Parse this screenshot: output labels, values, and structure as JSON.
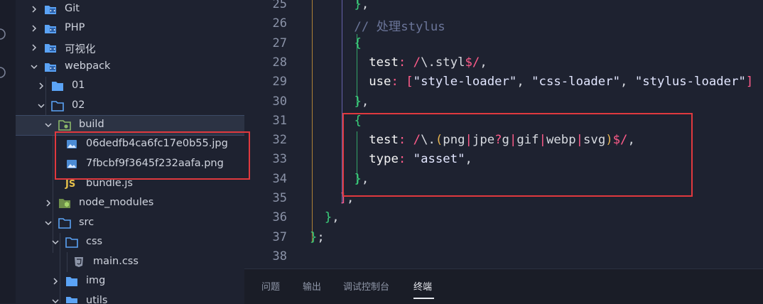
{
  "explorer": {
    "items": [
      {
        "label": "Git",
        "icon": "folder-git-icon"
      },
      {
        "label": "PHP",
        "icon": "folder-code-icon"
      },
      {
        "label": "可视化",
        "icon": "folder-code-icon"
      },
      {
        "label": "webpack",
        "icon": "folder-code-icon"
      },
      {
        "label": "01",
        "icon": "folder-icon"
      },
      {
        "label": "02",
        "icon": "folder-open-icon"
      },
      {
        "label": "build",
        "icon": "folder-build-icon"
      },
      {
        "label": "06dedfb4ca6fc17e0b55.jpg",
        "icon": "image-file-icon"
      },
      {
        "label": "7fbcbf9f3645f232aafa.png",
        "icon": "image-file-icon"
      },
      {
        "label": "bundle.js",
        "icon": "js-file-icon"
      },
      {
        "label": "node_modules",
        "icon": "folder-node-icon"
      },
      {
        "label": "src",
        "icon": "folder-open-icon"
      },
      {
        "label": "css",
        "icon": "folder-open-icon"
      },
      {
        "label": "main.css",
        "icon": "css-file-icon"
      },
      {
        "label": "img",
        "icon": "folder-icon"
      },
      {
        "label": "utils",
        "icon": "folder-icon"
      }
    ],
    "icons": {
      "js": "JS"
    }
  },
  "editor": {
    "line_numbers": [
      "25",
      "26",
      "27",
      "28",
      "29",
      "30",
      "31",
      "32",
      "33",
      "34",
      "35",
      "36",
      "37",
      "38"
    ],
    "lines": [
      [
        {
          "t": "      },"
        }
      ],
      [
        {
          "t": "      // 处理stylus"
        }
      ],
      [
        {
          "t": "      {"
        }
      ],
      [
        {
          "t": "        test: /\\.styl$/,"
        }
      ],
      [
        {
          "t": "        use: [\"style-loader\", \"css-loader\", \"stylus-loader\"]"
        }
      ],
      [
        {
          "t": "      },"
        }
      ],
      [
        {
          "t": "      {"
        }
      ],
      [
        {
          "t": "        test: /\\.(png|jpe?g|gif|webp|svg)$/,"
        }
      ],
      [
        {
          "t": "        type: \"asset\","
        }
      ],
      [
        {
          "t": "      },"
        }
      ],
      [
        {
          "t": "    ],"
        }
      ],
      [
        {
          "t": "  },"
        }
      ],
      [
        {
          "t": "};"
        }
      ],
      [
        {
          "t": ""
        }
      ]
    ]
  },
  "panel": {
    "tabs": [
      "问题",
      "输出",
      "调试控制台",
      "终端"
    ],
    "active_tab": "终端"
  },
  "colors": {
    "background": "#1e2230",
    "selection": "#2c3344",
    "highlight_box": "#e0393e",
    "keyword": "#ff5c8a",
    "string": "#e2e6ff",
    "regex": "#d7dae0",
    "comment": "#6b7599",
    "property": "#f5f5f5",
    "folder_blue": "#5ba3f5"
  }
}
